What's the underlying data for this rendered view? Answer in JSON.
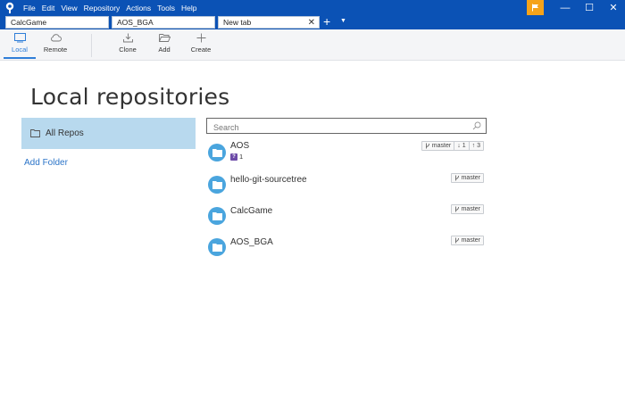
{
  "menu": [
    "File",
    "Edit",
    "View",
    "Repository",
    "Actions",
    "Tools",
    "Help"
  ],
  "window_controls": {
    "minimize": "—",
    "maximize": "☐",
    "close": "✕"
  },
  "tabs": [
    {
      "label": "CalcGame"
    },
    {
      "label": "AOS_BGA"
    },
    {
      "label": "New tab",
      "close": "✕"
    }
  ],
  "tab_add": "+",
  "tab_dropdown": "▼",
  "toolbar": {
    "local": "Local",
    "remote": "Remote",
    "clone": "Clone",
    "add": "Add",
    "create": "Create"
  },
  "page_title": "Local repositories",
  "sidebar": {
    "all_repos": "All Repos",
    "add_folder": "Add Folder"
  },
  "search": {
    "placeholder": "Search"
  },
  "repos": [
    {
      "name": "AOS",
      "badge_count": "1",
      "branch": "master",
      "behind": "1",
      "ahead": "3"
    },
    {
      "name": "hello-git-sourcetree",
      "branch": "master"
    },
    {
      "name": "CalcGame",
      "branch": "master"
    },
    {
      "name": "AOS_BGA",
      "branch": "master"
    }
  ],
  "icons": {
    "behind": "↓",
    "ahead": "↑",
    "badge_mark": "?",
    "branch": "branch-icon",
    "repo": "folder-icon"
  },
  "colors": {
    "titlebar": "#0b52b5",
    "accent": "#2f7ed8",
    "selected_row": "#b8d9ee",
    "repo_icon": "#4aa5de",
    "flag": "#f5a31a"
  }
}
